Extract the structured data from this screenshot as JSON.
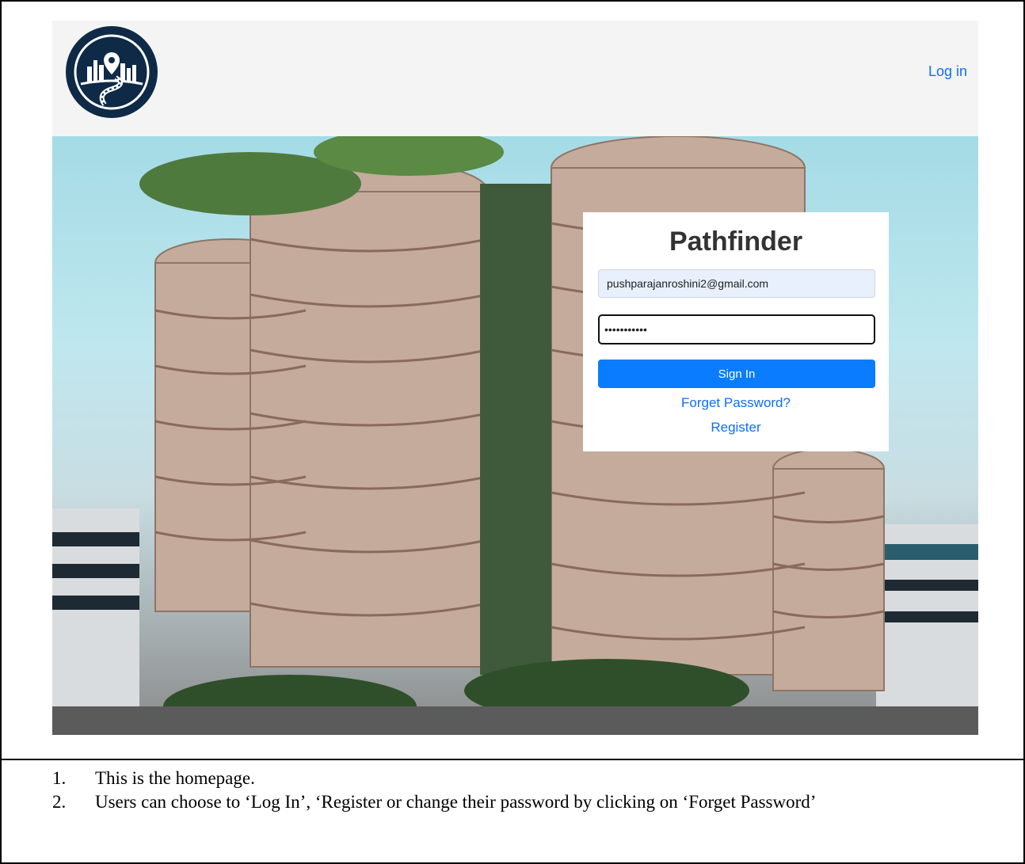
{
  "navbar": {
    "login_label": "Log in"
  },
  "login_card": {
    "title": "Pathfinder",
    "email_value": "pushparajanroshini2@gmail.com",
    "password_value": "mypassword1",
    "signin_label": "Sign In",
    "forget_label": "Forget Password?",
    "register_label": "Register"
  },
  "notes": [
    {
      "num": "1.",
      "text": "This is the homepage."
    },
    {
      "num": "2.",
      "text": "Users can choose to ‘Log In’, ‘Register or change their password by clicking on ‘Forget Password’"
    }
  ],
  "colors": {
    "accent": "#0a7cff",
    "logo_bg": "#0e2a47",
    "link": "#0d6efd"
  }
}
